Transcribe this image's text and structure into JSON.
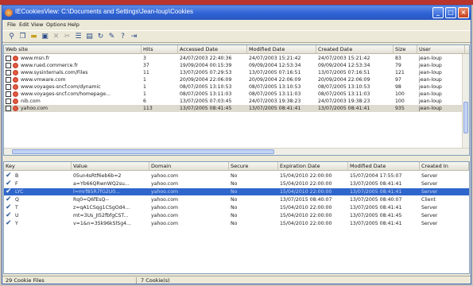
{
  "window": {
    "title": "IECookiesView: C:\\Documents and Settings\\Jean-loup\\Cookies",
    "controls": [
      "_",
      "□",
      "×"
    ]
  },
  "menu": [
    "File",
    "Edit",
    "View",
    "Options",
    "Help"
  ],
  "toolbar_icons": [
    "find-icon",
    "copy-icon",
    "open-folder-icon",
    "save-icon",
    "delete-icon",
    "cut-icon",
    "properties-icon",
    "html-report-icon",
    "refresh-icon",
    "edit-icon",
    "about-icon",
    "exit-icon"
  ],
  "sites_table": {
    "columns": [
      "Web site",
      "Hits",
      "Accessed Date",
      "Modified Date",
      "Created Date",
      "Size",
      "User"
    ],
    "rows": [
      {
        "site": "www.msn.fr",
        "hits": "3",
        "accessed": "24/07/2003 22:40:36",
        "modified": "24/07/2003 15:21:42",
        "created": "24/07/2003 15:21:42",
        "size": "83",
        "user": "jean-loup"
      },
      {
        "site": "www.rued.commerce.fr",
        "hits": "37",
        "accessed": "19/09/2004 00:15:39",
        "modified": "09/09/2004 12:53:34",
        "created": "09/09/2004 12:53:34",
        "size": "79",
        "user": "jean-loup"
      },
      {
        "site": "www.sysinternals.com/Files",
        "hits": "11",
        "accessed": "13/07/2005 07:29:53",
        "modified": "13/07/2005 07:16:51",
        "created": "13/07/2005 07:16:51",
        "size": "121",
        "user": "jean-loup"
      },
      {
        "site": "www.vmware.com",
        "hits": "1",
        "accessed": "20/09/2004 22:06:09",
        "modified": "20/09/2004 22:06:09",
        "created": "20/09/2004 22:06:09",
        "size": "97",
        "user": "jean-loup"
      },
      {
        "site": "www.voyages-sncf.com/dynamic",
        "hits": "1",
        "accessed": "08/07/2005 13:10:53",
        "modified": "08/07/2005 13:10:53",
        "created": "08/07/2005 13:10:53",
        "size": "98",
        "user": "jean-loup"
      },
      {
        "site": "www.voyages-sncf.com/homepage...",
        "hits": "1",
        "accessed": "08/07/2005 13:11:03",
        "modified": "08/07/2005 13:11:03",
        "created": "08/07/2005 13:11:03",
        "size": "100",
        "user": "jean-loup"
      },
      {
        "site": "nib.com",
        "hits": "6",
        "accessed": "13/07/2005 07:03:45",
        "modified": "24/07/2003 19:38:23",
        "created": "24/07/2003 19:38:23",
        "size": "100",
        "user": "jean-loup"
      },
      {
        "site": "yahoo.com",
        "hits": "113",
        "accessed": "13/07/2005 08:41:45",
        "modified": "13/07/2005 08:41:41",
        "created": "13/07/2005 08:41:41",
        "size": "935",
        "user": "jean-loup"
      }
    ]
  },
  "cookies_table": {
    "columns": [
      "Key",
      "Value",
      "Domain",
      "Secure",
      "Expiration Date",
      "Modified Date",
      "Created In"
    ],
    "rows": [
      {
        "key": "B",
        "value": "05un4sRtf6eb6b=2",
        "domain": "yahoo.com",
        "secure": "No",
        "expires": "15/04/2010 22:00:00",
        "modified": "15/07/2004 17:55:07",
        "created_in": "Server"
      },
      {
        "key": "F",
        "value": "a=Yb66QRwnWQ2su...",
        "domain": "yahoo.com",
        "secure": "No",
        "expires": "15/04/2010 22:00:00",
        "modified": "13/07/2005 08:41:41",
        "created_in": "Server"
      },
      {
        "key": "LYC",
        "value": "l=mrf85R7fG2U0...",
        "domain": "yahoo.com",
        "secure": "No",
        "expires": "15/04/2010 22:00:00",
        "modified": "13/07/2005 08:41:41",
        "created_in": "Server"
      },
      {
        "key": "Q",
        "value": "Rq0=Q6fEsQ--",
        "domain": "yahoo.com",
        "secure": "No",
        "expires": "13/07/2015 08:40:07",
        "modified": "13/07/2005 08:40:07",
        "created_in": "Client"
      },
      {
        "key": "T",
        "value": "z=qA1CSqg1CSgOd4...",
        "domain": "yahoo.com",
        "secure": "No",
        "expires": "15/04/2010 22:00:00",
        "modified": "13/07/2005 08:41:41",
        "created_in": "Server"
      },
      {
        "key": "U",
        "value": "mt=3Us_JI52fbfgCST...",
        "domain": "yahoo.com",
        "secure": "No",
        "expires": "15/04/2010 22:00:00",
        "modified": "13/07/2005 08:41:45",
        "created_in": "Server"
      },
      {
        "key": "Y",
        "value": "v=1&n=3Sk96kSlSg4...",
        "domain": "yahoo.com",
        "secure": "No",
        "expires": "15/04/2010 22:00:00",
        "modified": "13/07/2005 08:41:41",
        "created_in": "Server"
      }
    ],
    "highlighted_row": 2
  },
  "status": {
    "files": "29 Cookie Files",
    "cookies": "7 Cookie(s)"
  },
  "colors": {
    "titlebar": "#2f62d4",
    "highlight": "#2f66cc",
    "brand_red": "#b8342c"
  }
}
